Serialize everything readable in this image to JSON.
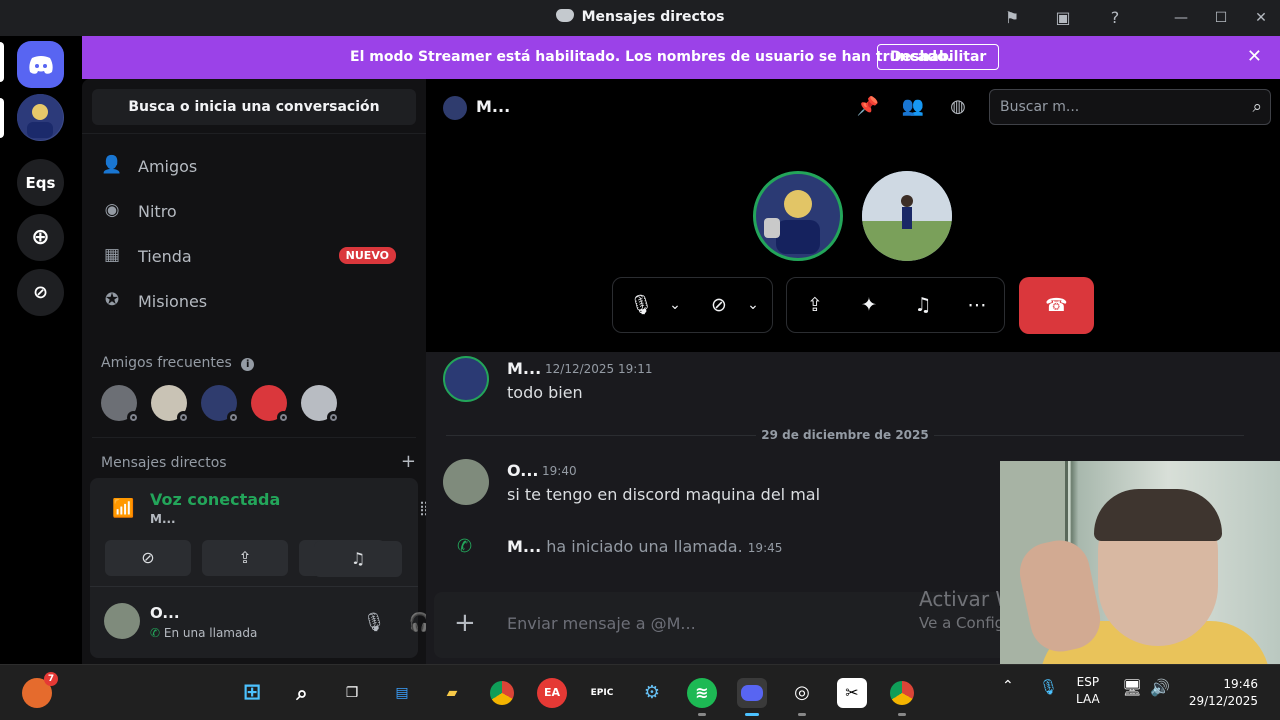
{
  "window": {
    "title": "Mensajes directos"
  },
  "rail": {
    "server_eqs": "Eqs"
  },
  "banner": {
    "message": "El modo Streamer está habilitado. Los nombres de usuario se han truncado.",
    "button": "Deshabilitar"
  },
  "dm": {
    "search_label": "Busca o inicia una conversación",
    "nav": [
      {
        "label": "Amigos",
        "icon": "friends-icon"
      },
      {
        "label": "Nitro",
        "icon": "nitro-icon"
      },
      {
        "label": "Tienda",
        "icon": "shop-icon",
        "badge": "NUEVO"
      },
      {
        "label": "Misiones",
        "icon": "quests-icon"
      }
    ],
    "frequent_friends_label": "Amigos frecuentes",
    "direct_messages_label": "Mensajes directos"
  },
  "voice": {
    "status": "Voz conectada",
    "channel": "M..."
  },
  "user": {
    "name": "O...",
    "status": "En una llamada"
  },
  "chat_header": {
    "name": "M...",
    "search_placeholder": "Buscar m..."
  },
  "messages": [
    {
      "author": "M...",
      "time": "12/12/2025 19:11",
      "text": "todo bien"
    },
    {
      "author": "O...",
      "time": "19:40",
      "text": "si te tengo en discord maquina del mal"
    }
  ],
  "date_divider": "29 de diciembre de 2025",
  "system_message": {
    "author": "M...",
    "text": "ha iniciado una llamada.",
    "time": "19:45"
  },
  "composer": {
    "placeholder": "Enviar mensaje a @M..."
  },
  "watermark": {
    "title": "Activar Windows",
    "subtitle": "Ve a Configuración"
  },
  "taskbar": {
    "tray_lang": "ESP",
    "tray_layout": "LAA",
    "time": "19:46",
    "date": "29/12/2025",
    "notification_count": "7"
  },
  "colors": {
    "banner": "#9b42e8",
    "discord_blurple": "#5865f2",
    "voice_green": "#23a55a",
    "hangup_red": "#da373c"
  }
}
